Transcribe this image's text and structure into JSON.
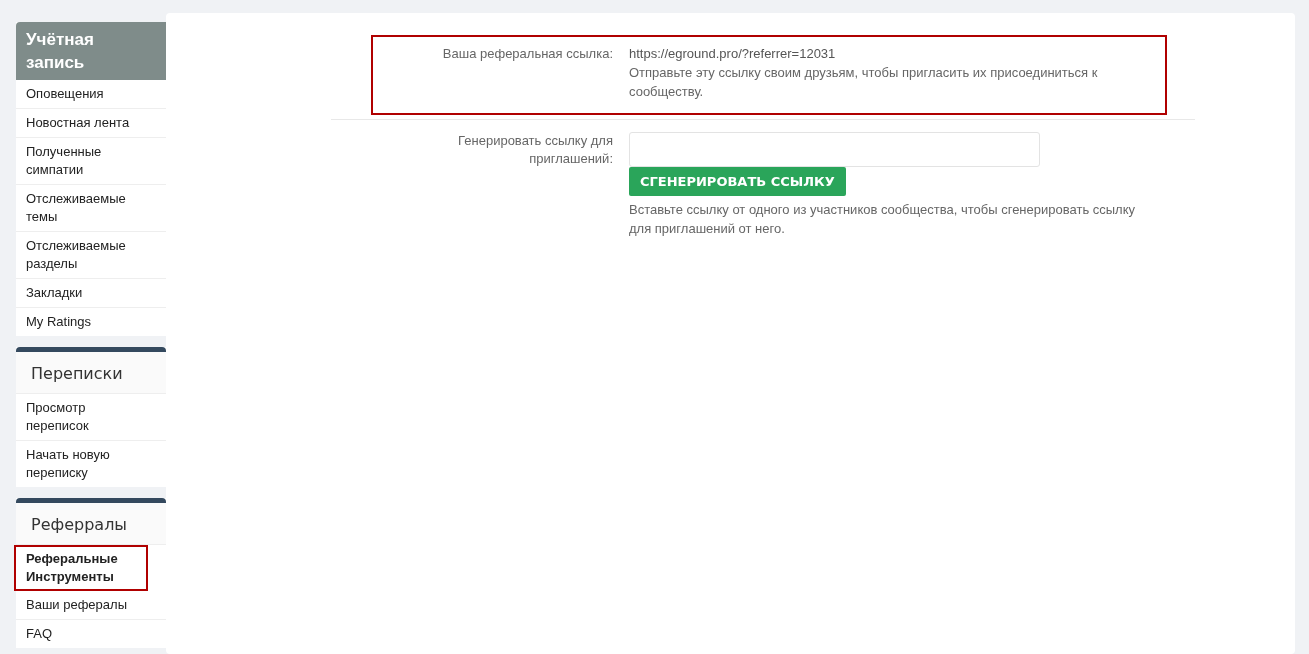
{
  "sidebar": {
    "sections": [
      {
        "kind": "account",
        "title": "Учётная запись",
        "items": [
          {
            "label": "Оповещения",
            "selected": false,
            "highlighted": false
          },
          {
            "label": "Новостная лента",
            "selected": false,
            "highlighted": false
          },
          {
            "label": "Полученные симпатии",
            "selected": false,
            "highlighted": false
          },
          {
            "label": "Отслеживаемые темы",
            "selected": false,
            "highlighted": false
          },
          {
            "label": "Отслеживаемые разделы",
            "selected": false,
            "highlighted": false
          },
          {
            "label": "Закладки",
            "selected": false,
            "highlighted": false
          },
          {
            "label": "My Ratings",
            "selected": false,
            "highlighted": false
          }
        ]
      },
      {
        "kind": "group",
        "title": "Переписки",
        "items": [
          {
            "label": "Просмотр переписок",
            "selected": false,
            "highlighted": false
          },
          {
            "label": "Начать новую переписку",
            "selected": false,
            "highlighted": false
          }
        ]
      },
      {
        "kind": "group",
        "title": "Реферралы",
        "items": [
          {
            "label": "Реферальные Инструменты",
            "selected": true,
            "highlighted": true
          },
          {
            "label": "Ваши рефералы",
            "selected": false,
            "highlighted": false
          },
          {
            "label": "FAQ",
            "selected": false,
            "highlighted": false
          }
        ]
      }
    ]
  },
  "form": {
    "rows": [
      {
        "kind": "text",
        "highlighted": true,
        "label": "Ваша реферальная ссылка:",
        "value": "https://eground.pro/?referrer=12031",
        "hint": "Отправьте эту ссылку своим друзьям, чтобы пригласить их присоединиться к сообществу."
      },
      {
        "kind": "input",
        "highlighted": false,
        "label": "Генерировать ссылку для приглашений:",
        "button": "СГЕНЕРИРОВАТЬ ССЫЛКУ",
        "hint": "Вставьте ссылку от одного из участников сообщества, чтобы сгенерировать ссылку для приглашений от него."
      }
    ]
  }
}
